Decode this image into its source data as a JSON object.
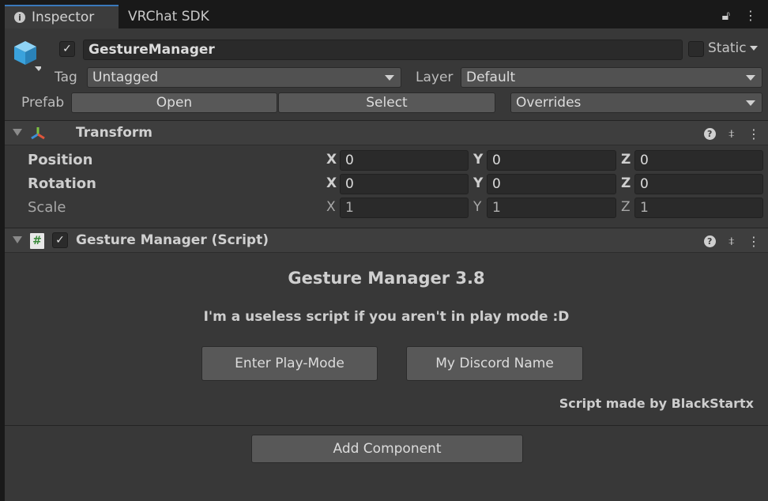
{
  "tabs": {
    "inspector": "Inspector",
    "vrchat_sdk": "VRChat SDK"
  },
  "object": {
    "active": true,
    "name": "GestureManager",
    "static_label": "Static",
    "tag_label": "Tag",
    "tag_value": "Untagged",
    "layer_label": "Layer",
    "layer_value": "Default",
    "prefab_label": "Prefab",
    "open_label": "Open",
    "select_label": "Select",
    "overrides_label": "Overrides"
  },
  "transform": {
    "title": "Transform",
    "rows": [
      {
        "label": "Position",
        "x": "0",
        "y": "0",
        "z": "0"
      },
      {
        "label": "Rotation",
        "x": "0",
        "y": "0",
        "z": "0"
      },
      {
        "label": "Scale",
        "x": "1",
        "y": "1",
        "z": "1"
      }
    ],
    "axis": {
      "x": "X",
      "y": "Y",
      "z": "Z"
    }
  },
  "script": {
    "title": "Gesture Manager (Script)",
    "heading": "Gesture Manager 3.8",
    "message": "I'm a useless script if you aren't in play mode :D",
    "enter_play_label": "Enter Play-Mode",
    "discord_label": "My Discord Name",
    "credit": "Script made by BlackStartx"
  },
  "add_component_label": "Add Component",
  "colors": {
    "accent_tab": "#3a79bb",
    "panel_bg": "#383838",
    "cube_icon": "#4fb3e6"
  }
}
